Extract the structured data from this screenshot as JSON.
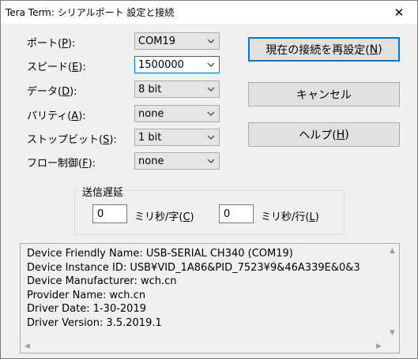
{
  "window": {
    "title": "Tera Term: シリアルポート 設定と接続",
    "close_glyph": "✕"
  },
  "fields": [
    {
      "label_pre": "ポート(",
      "accel": "P",
      "label_post": "):",
      "value": "COM19"
    },
    {
      "label_pre": "スピード(",
      "accel": "E",
      "label_post": "):",
      "value": "1500000"
    },
    {
      "label_pre": "データ(",
      "accel": "D",
      "label_post": "):",
      "value": "8 bit"
    },
    {
      "label_pre": "パリティ(",
      "accel": "A",
      "label_post": "):",
      "value": "none"
    },
    {
      "label_pre": "ストップビット(",
      "accel": "S",
      "label_post": "):",
      "value": "1 bit"
    },
    {
      "label_pre": "フロー制御(",
      "accel": "F",
      "label_post": "):",
      "value": "none"
    }
  ],
  "buttons": {
    "reconnect": {
      "pre": "現在の接続を再設定(",
      "accel": "N",
      "post": ")"
    },
    "cancel": {
      "pre": "キャンセル",
      "accel": "",
      "post": ""
    },
    "help": {
      "pre": "ヘルプ(",
      "accel": "H",
      "post": ")"
    }
  },
  "delay": {
    "group_title": "送信遅延",
    "char_value": "0",
    "char_label_pre": "ミリ秒/字(",
    "char_label_accel": "C",
    "char_label_post": ")",
    "line_value": "0",
    "line_label_pre": "ミリ秒/行(",
    "line_label_accel": "L",
    "line_label_post": ")"
  },
  "device_info": [
    "Device Friendly Name: USB-SERIAL CH340 (COM19)",
    "Device Instance ID: USB¥VID_1A86&PID_7523¥9&46A339E&0&3",
    "Device Manufacturer: wch.cn",
    "Provider Name: wch.cn",
    "Driver Date: 1-30-2019",
    "Driver Version: 3.5.2019.1"
  ],
  "icons": {
    "dropdown": "chevron-down-icon",
    "close": "close-icon"
  },
  "colors": {
    "focus_border": "#0078d7",
    "dialog_bg": "#f0f0f0"
  }
}
